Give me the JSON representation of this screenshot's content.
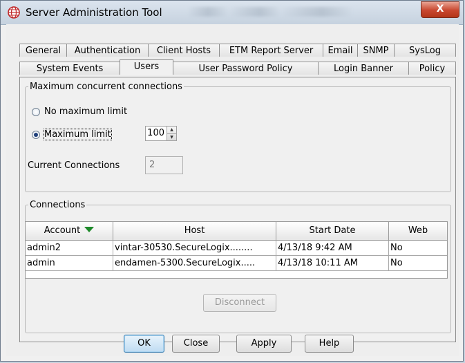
{
  "window": {
    "title": "Server Administration Tool",
    "close_label": "X"
  },
  "tabs_row1": [
    "General",
    "Authentication",
    "Client Hosts",
    "ETM Report Server",
    "Email",
    "SNMP",
    "SysLog"
  ],
  "tabs_row2": [
    "System Events",
    "Users",
    "User Password Policy",
    "Login Banner",
    "Policy"
  ],
  "active_tab": "Users",
  "max_connections": {
    "legend": "Maximum concurrent connections",
    "no_limit_label": "No maximum limit",
    "limit_label": "Maximum limit",
    "selected": "Maximum limit",
    "limit_value": "100",
    "current_label": "Current Connections",
    "current_value": "2"
  },
  "connections": {
    "legend": "Connections",
    "columns": [
      "Account",
      "Host",
      "Start Date",
      "Web"
    ],
    "sort_column": "Account",
    "rows": [
      {
        "account": "admin2",
        "host": "vintar-30530.SecureLogix........",
        "start_date": "4/13/18 9:42 AM",
        "web": "No"
      },
      {
        "account": "admin",
        "host": "endamen-5300.SecureLogix.....",
        "start_date": "4/13/18 10:11 AM",
        "web": "No"
      }
    ],
    "disconnect_label": "Disconnect"
  },
  "buttons": {
    "ok": "OK",
    "close": "Close",
    "apply": "Apply",
    "help": "Help"
  },
  "colors": {
    "sort_arrow": "#1e8a2a",
    "close_button": "#c8462e",
    "default_button": "#bfdcf2"
  }
}
